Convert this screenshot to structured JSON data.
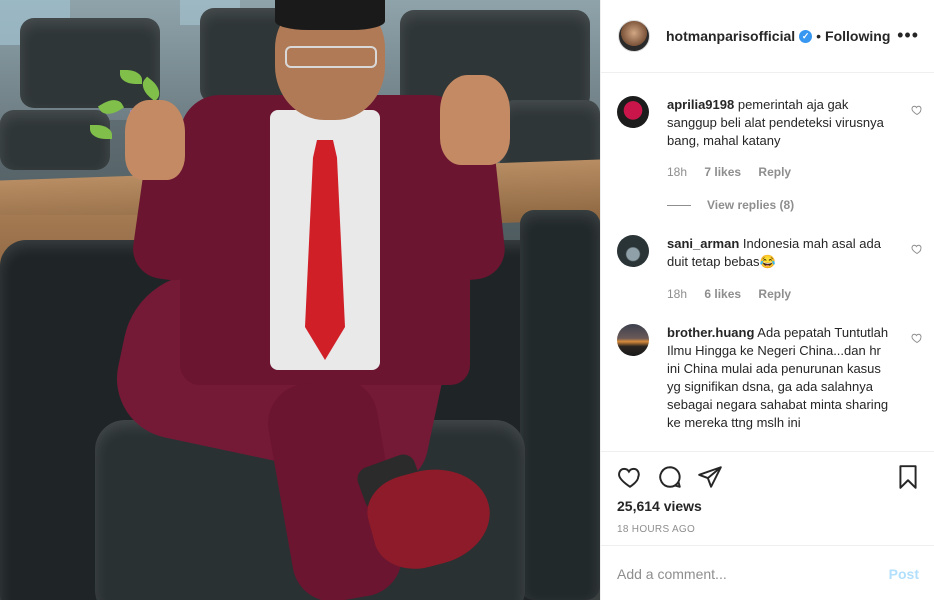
{
  "header": {
    "username": "hotmanparisofficial",
    "verified_icon": "verified-badge-icon",
    "separator": "•",
    "follow_status": "Following",
    "more_icon": "more-options-icon"
  },
  "comments": [
    {
      "username": "aprilia9198",
      "text": "pemerintah aja gak sanggup beli alat pendeteksi virusnya bang, mahal katany",
      "time": "18h",
      "likes": "7 likes",
      "reply": "Reply",
      "view_replies": "View replies (8)"
    },
    {
      "username": "sani_arman",
      "text": "Indonesia mah asal ada duit tetap bebas😂",
      "time": "18h",
      "likes": "6 likes",
      "reply": "Reply"
    },
    {
      "username": "brother.huang",
      "text": "Ada pepatah Tuntutlah Ilmu Hingga ke Negeri China...dan hr ini China mulai ada penurunan kasus yg signifikan dsna, ga ada salahnya sebagai negara sahabat minta sharing ke mereka ttng mslh ini"
    }
  ],
  "actions": {
    "like_icon": "heart-icon",
    "comment_icon": "comment-icon",
    "share_icon": "share-icon",
    "save_icon": "bookmark-icon"
  },
  "views": "25,614 views",
  "timestamp": "18 HOURS AGO",
  "add_comment": {
    "placeholder": "Add a comment...",
    "post_label": "Post"
  },
  "colors": {
    "verified": "#3897f0",
    "post_disabled": "#b2dffc",
    "muted_text": "#8e8e8e"
  }
}
